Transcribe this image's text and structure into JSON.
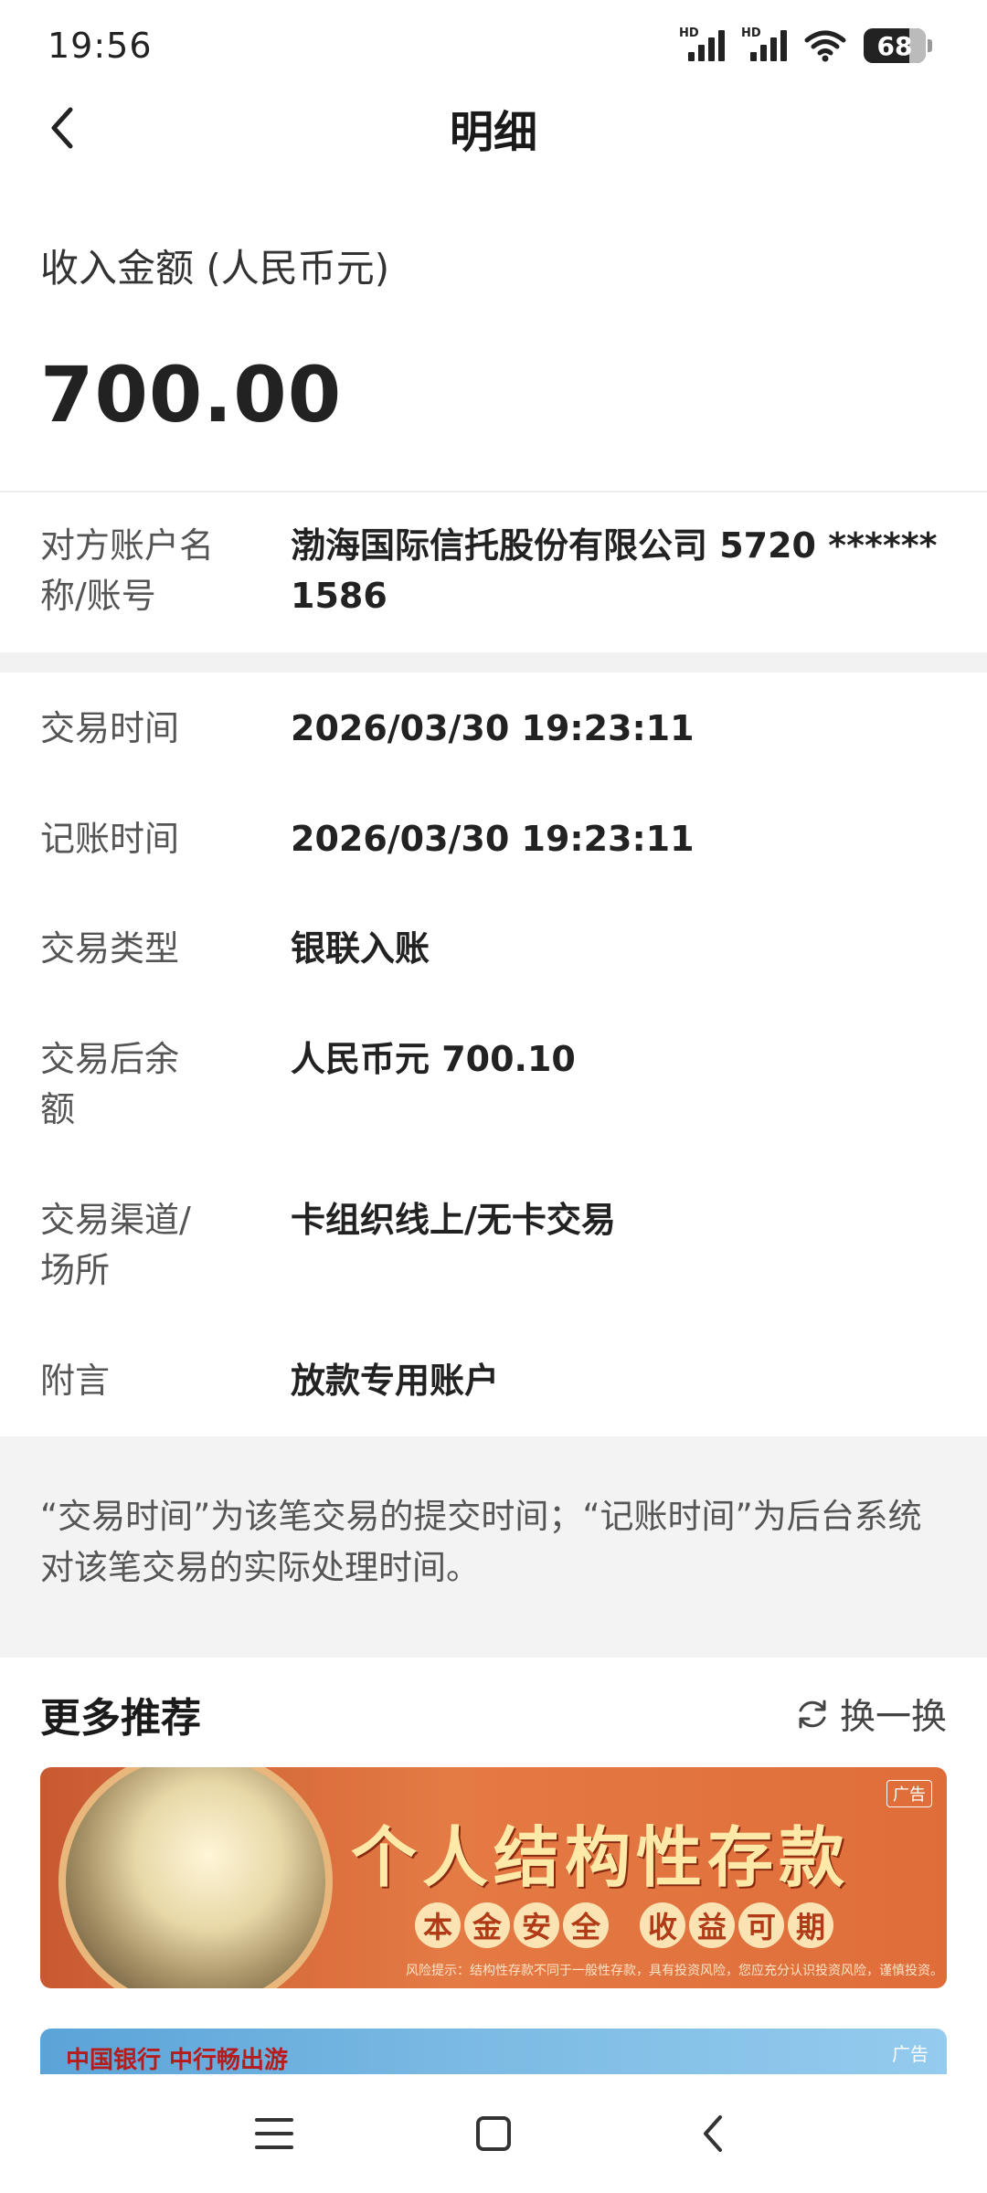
{
  "status": {
    "time": "19:56",
    "hd1": "HD",
    "hd2": "HD",
    "battery": "68"
  },
  "nav": {
    "title": "明细"
  },
  "amount": {
    "label": "收入金额 (人民币元)",
    "value": "700.00"
  },
  "counterparty": {
    "label": "对方账户名称/账号",
    "value": "渤海国际信托股份有限公司 5720 ****** 1586"
  },
  "details": [
    {
      "label": "交易时间",
      "value": "2026/03/30 19:23:11"
    },
    {
      "label": "记账时间",
      "value": "2026/03/30 19:23:11"
    },
    {
      "label": "交易类型",
      "value": "银联入账"
    },
    {
      "label": "交易后余额",
      "value": "人民币元 700.10"
    },
    {
      "label": "交易渠道/场所",
      "value": "卡组织线上/无卡交易"
    },
    {
      "label": "附言",
      "value": "放款专用账户"
    }
  ],
  "note": {
    "text": "“交易时间”为该笔交易的提交时间；“记账时间”为后台系统对该笔交易的实际处理时间。"
  },
  "more": {
    "title": "更多推荐",
    "refresh_label": "换一换"
  },
  "banner": {
    "title": "个人结构性存款",
    "pills_left": [
      "本",
      "金",
      "安",
      "全"
    ],
    "pills_right": [
      "收",
      "益",
      "可",
      "期"
    ],
    "risk": "风险提示：结构性存款不同于一般性存款，具有投资风险，您应充分认识投资风险，谨慎投资。",
    "ad_tag": "广告"
  },
  "banner2": {
    "logo": "中国银行 中行畅出游",
    "ad_tag": "广告"
  }
}
